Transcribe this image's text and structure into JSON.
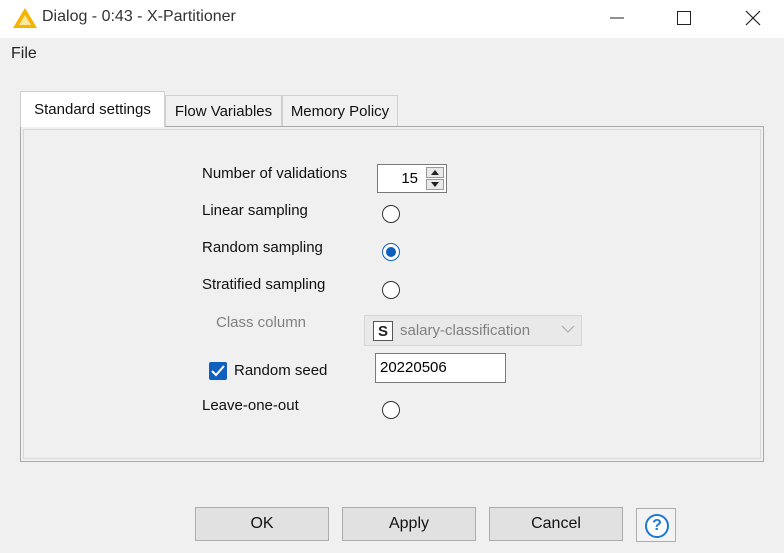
{
  "window": {
    "title": "Dialog - 0:43 - X-Partitioner",
    "minimize_icon": "minimize-icon",
    "maximize_icon": "maximize-icon",
    "close_icon": "close-icon"
  },
  "menu": {
    "file": "File"
  },
  "tabs": [
    {
      "label": "Standard settings",
      "active": true
    },
    {
      "label": "Flow Variables",
      "active": false
    },
    {
      "label": "Memory Policy",
      "active": false
    }
  ],
  "settings": {
    "num_validations_label": "Number of validations",
    "num_validations_value": "15",
    "linear_label": "Linear sampling",
    "random_label": "Random sampling",
    "stratified_label": "Stratified sampling",
    "sampling_selected": "Random sampling",
    "class_column_label": "Class column",
    "class_column_type": "S",
    "class_column_value": "salary-classification",
    "random_seed_label": "Random seed",
    "random_seed_checked": true,
    "random_seed_value": "20220506",
    "leave_one_out_label": "Leave-one-out"
  },
  "buttons": {
    "ok": "OK",
    "apply": "Apply",
    "cancel": "Cancel",
    "help": "?"
  },
  "colors": {
    "accent": "#0f5fbf",
    "warning_icon": "#f5b400"
  }
}
